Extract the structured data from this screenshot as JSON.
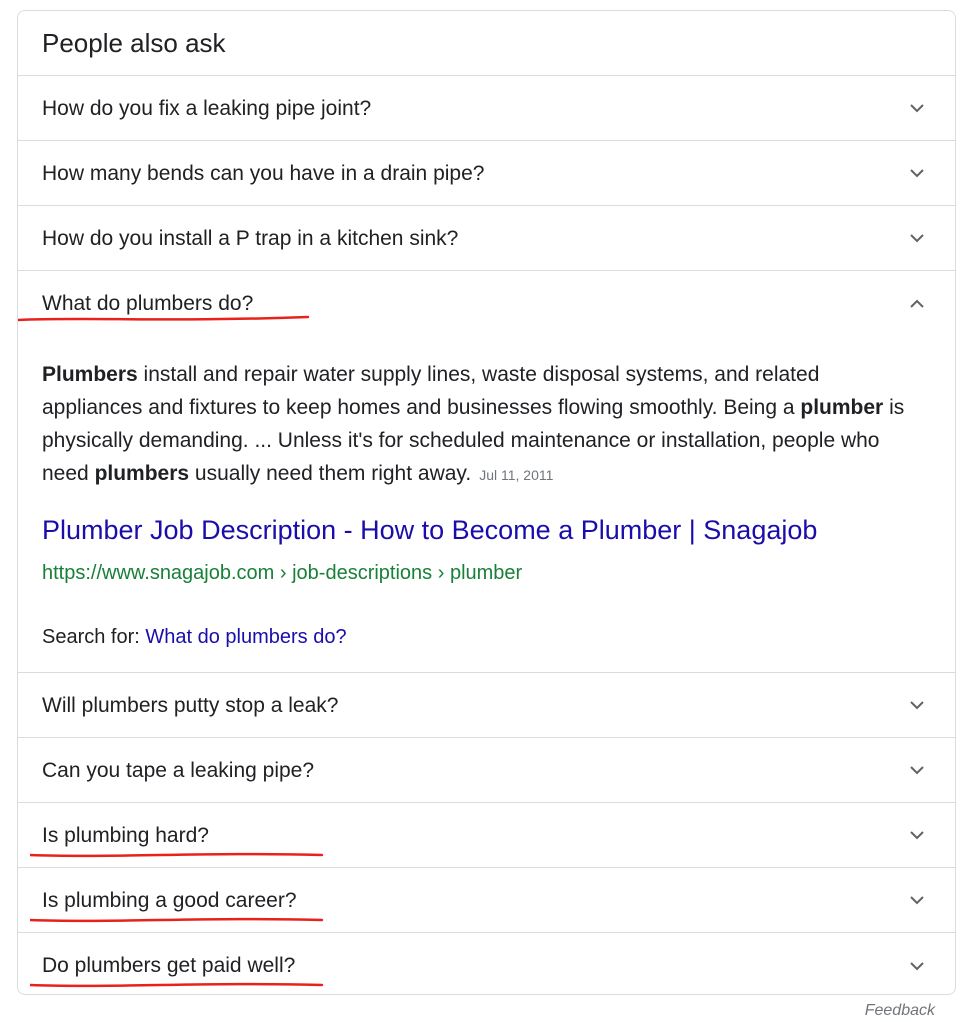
{
  "header": {
    "title": "People also ask"
  },
  "questions_top": [
    {
      "label": "How do you fix a leaking pipe joint?"
    },
    {
      "label": "How many bends can you have in a drain pipe?"
    },
    {
      "label": "How do you install a P trap in a kitchen sink?"
    }
  ],
  "expanded": {
    "question": "What do plumbers do?",
    "snippet": {
      "b1": "Plumbers",
      "t1": " install and repair water supply lines, waste disposal systems, and related appliances and fixtures to keep homes and businesses flowing smoothly. Being a ",
      "b2": "plumber",
      "t2": " is physically demanding. ... Unless it's for scheduled maintenance or installation, people who need ",
      "b3": "plumbers",
      "t3": " usually need them right away.",
      "date": "Jul 11, 2011"
    },
    "result": {
      "title": "Plumber Job Description - How to Become a Plumber | Snagajob",
      "url": "https://www.snagajob.com › job-descriptions › plumber"
    },
    "search_for": {
      "prefix": "Search for: ",
      "link": "What do plumbers do?"
    }
  },
  "questions_bottom": [
    {
      "label": "Will plumbers putty stop a leak?"
    },
    {
      "label": "Can you tape a leaking pipe?"
    },
    {
      "label": "Is plumbing hard?"
    },
    {
      "label": "Is plumbing a good career?"
    },
    {
      "label": "Do plumbers get paid well?"
    }
  ],
  "footer": {
    "feedback": "Feedback"
  },
  "colors": {
    "accent_link": "#1a0dab",
    "url_green": "#188038",
    "annotation_red": "#e8221b",
    "divider": "#dadce0"
  },
  "icons": {
    "collapsed": "chevron-down-icon",
    "expanded": "chevron-up-icon"
  }
}
